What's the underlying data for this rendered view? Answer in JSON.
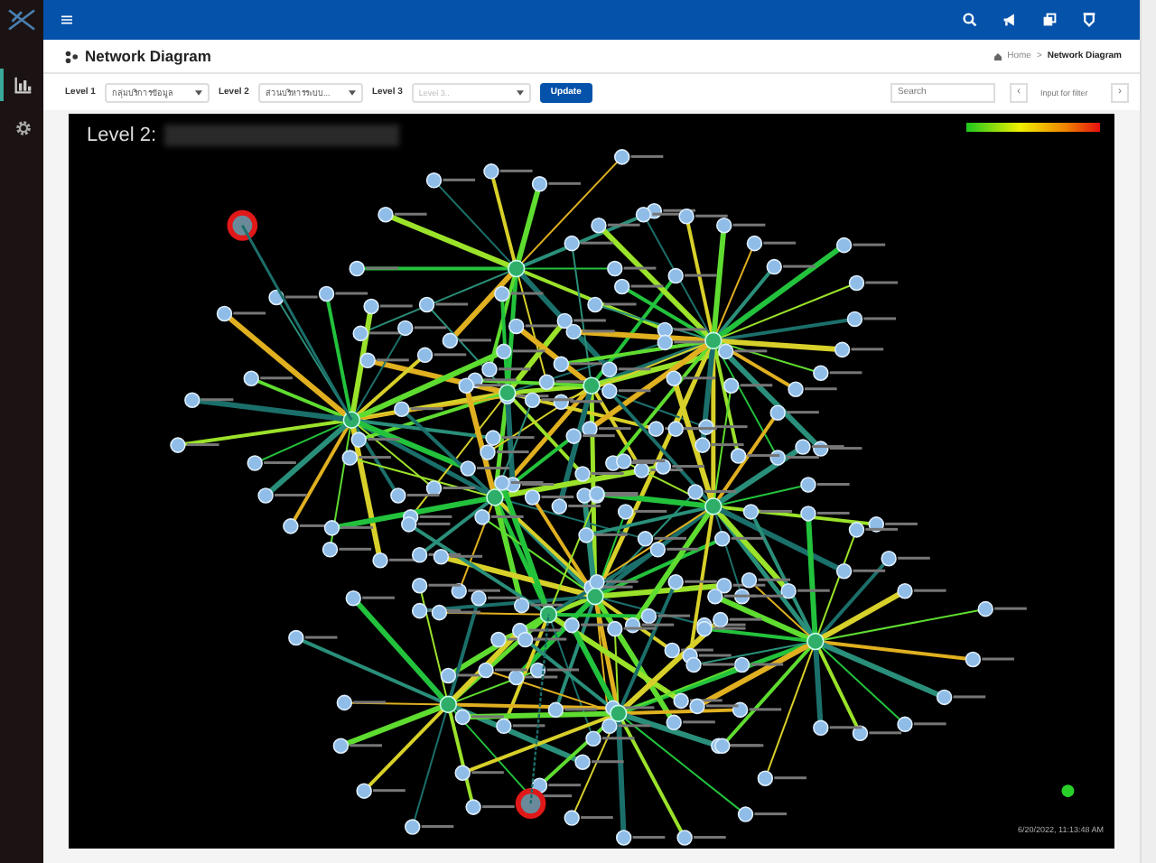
{
  "sidebar": {
    "items": [
      {
        "kind": "chart",
        "selected": true
      },
      {
        "kind": "settings",
        "selected": false
      }
    ]
  },
  "top_bar": {
    "icons": [
      {
        "kind": "search"
      },
      {
        "kind": "megaphone"
      },
      {
        "kind": "copy"
      },
      {
        "kind": "shield"
      }
    ]
  },
  "page": {
    "title": "Network Diagram",
    "breadcrumb": [
      "Home",
      "Network Diagram"
    ],
    "breadcrumb_separator": ">"
  },
  "filters": [
    {
      "label": "Level 1",
      "value": "กลุ่มบริการข้อมูล"
    },
    {
      "label": "Level 2",
      "value": "ส่วนบริหารระบบ..."
    },
    {
      "label": "Level 3",
      "placeholder": "Level 3.."
    }
  ],
  "update_button": "Update",
  "search": {
    "placeholder": "Search"
  },
  "filter_nav": {
    "prev": "‹",
    "placeholder": "Input for filter",
    "next": "›"
  },
  "diagram": {
    "title": "Level 2:",
    "timestamp": "6/20/2022, 11:13:48 AM"
  }
}
